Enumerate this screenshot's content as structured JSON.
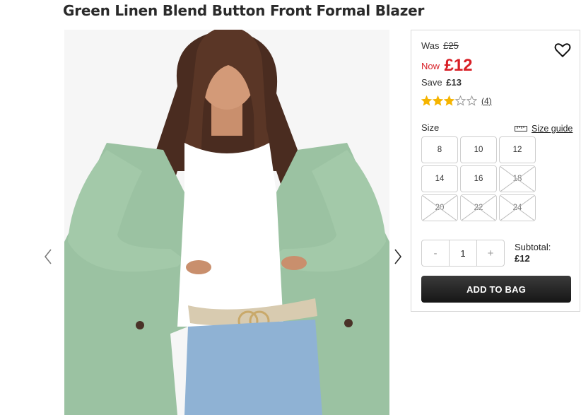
{
  "product": {
    "title": "Green Linen Blend Button Front Formal Blazer"
  },
  "gallery": {
    "image_name": "model-wearing-green-blazer",
    "prev_icon": "chevron-left-icon",
    "next_icon": "chevron-right-icon"
  },
  "pricing": {
    "was_label": "Was",
    "was_price": "£25",
    "now_label": "Now",
    "now_price": "£12",
    "save_label": "Save",
    "save_amount": "£13",
    "accent_color": "#d81f26"
  },
  "rating": {
    "stars_filled": 3,
    "stars_total": 5,
    "review_count": "(4)",
    "star_color": "#f5b400"
  },
  "size": {
    "label": "Size",
    "guide_label": "Size guide",
    "options": [
      {
        "label": "8",
        "available": true
      },
      {
        "label": "10",
        "available": true
      },
      {
        "label": "12",
        "available": true
      },
      {
        "label": "14",
        "available": true
      },
      {
        "label": "16",
        "available": true
      },
      {
        "label": "18",
        "available": false
      },
      {
        "label": "20",
        "available": false
      },
      {
        "label": "22",
        "available": false
      },
      {
        "label": "24",
        "available": false
      }
    ]
  },
  "quantity": {
    "minus": "-",
    "value": "1",
    "plus": "+"
  },
  "subtotal": {
    "label": "Subtotal:",
    "value": "£12"
  },
  "actions": {
    "add_to_bag": "ADD TO BAG"
  }
}
